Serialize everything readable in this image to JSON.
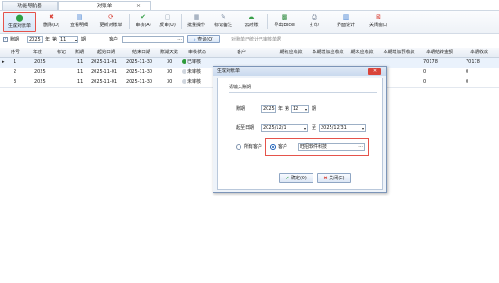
{
  "tabs": [
    {
      "label": "功能导航器"
    },
    {
      "label": "对账单",
      "close": "×"
    }
  ],
  "toolbar": {
    "gen": "生成对账单",
    "del": "删除(D)",
    "view": "查看明细",
    "update": "更新对账单",
    "audit": "审核(A)",
    "unaudit": "反审(U)",
    "batch": "批量操作",
    "mark": "标记备注",
    "cloud": "云对账",
    "excel": "导出Excel",
    "print": "打印",
    "layout": "界面设计",
    "close": "关闭窗口"
  },
  "filter": {
    "period_check": "✓",
    "period_label": "账期",
    "year": "2025",
    "year_unit": "年",
    "month_prefix": "第",
    "month": "11",
    "month_unit": "期",
    "customer_label": "客户",
    "customer_value": "",
    "query": "查询(Q)",
    "hint": "对账单已统计已审核单据"
  },
  "grid": {
    "headers": [
      "序号",
      "年度",
      "标记",
      "账期",
      "起始日期",
      "结束日期",
      "账期天数",
      "审核状态",
      "客户",
      "期初应收款",
      "本期增加应收款",
      "期末应收款",
      "本期增加预收款",
      "本期结转金额",
      "本期收款"
    ],
    "rows": [
      {
        "marker": "▸",
        "no": "1",
        "year": "2025",
        "mark": "",
        "period": "11",
        "start": "2025-11-01",
        "end": "2025-11-30",
        "days": "30",
        "status": "已审核",
        "customer": "",
        "begin": "",
        "incr": "",
        "endar": "",
        "adv": "",
        "carry": "70178",
        "recv": "70178"
      },
      {
        "marker": "",
        "no": "2",
        "year": "2025",
        "mark": "",
        "period": "11",
        "start": "2025-11-01",
        "end": "2025-11-30",
        "days": "30",
        "status": "未审核",
        "customer": "",
        "begin": "",
        "incr": "",
        "endar": "",
        "adv": "",
        "carry": "0",
        "recv": "0"
      },
      {
        "marker": "",
        "no": "3",
        "year": "2025",
        "mark": "",
        "period": "11",
        "start": "2025-11-01",
        "end": "2025-11-30",
        "days": "30",
        "status": "未审核",
        "customer": "",
        "begin": "",
        "incr": "",
        "endar": "",
        "adv": "",
        "carry": "0",
        "recv": "0"
      }
    ],
    "status_colors": {
      "approved": "#2e9b3a",
      "pending": "#d0d6de"
    }
  },
  "dialog": {
    "title": "生成对账单",
    "close": "✕",
    "prompt": "请输入账期",
    "period_label": "账期",
    "year": "2025",
    "year_unit": "年",
    "month_prefix": "第",
    "month": "12",
    "month_unit": "期",
    "date_label": "起至日期",
    "start": "2025/12/1",
    "to": "至",
    "end": "2025/12/31",
    "all_customers": "所有客户",
    "customer_radio": "客户",
    "customer_value": "旺招软件科技",
    "ellipsis": "···",
    "ok": "确定(O)",
    "close_btn": "关闭(C)"
  },
  "colors": {
    "highlight": "#e5534b",
    "accent": "#1b5fb8"
  }
}
